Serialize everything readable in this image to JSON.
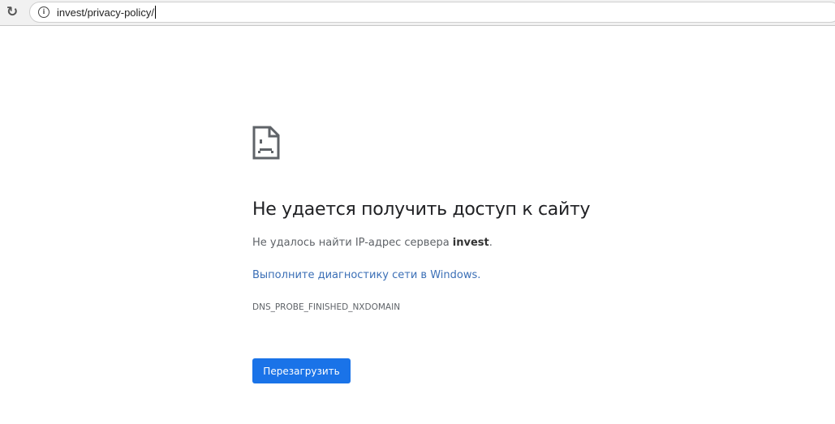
{
  "browser": {
    "url": "invest/privacy-policy/",
    "reload_icon": "reload-icon",
    "info_icon": "info-icon"
  },
  "error": {
    "title": "Не удается получить доступ к сайту",
    "message_prefix": "Не удалось найти IP-адрес сервера ",
    "message_host": "invest",
    "message_suffix": ".",
    "diagnostics_link": "Выполните диагностику сети в Windows",
    "diagnostics_suffix": ".",
    "error_code": "DNS_PROBE_FINISHED_NXDOMAIN",
    "reload_button": "Перезагрузить"
  }
}
